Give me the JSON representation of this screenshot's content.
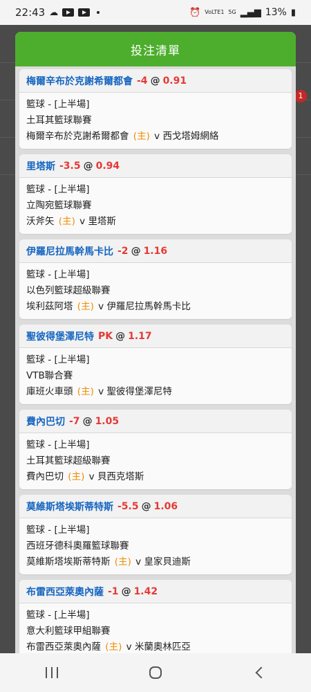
{
  "status_bar": {
    "time": "22:43",
    "battery": "13%",
    "network": "5G",
    "volte": "VoLTE1"
  },
  "background": {
    "badge_count": "1"
  },
  "modal": {
    "title": "投注清單",
    "home_marker": "(主)",
    "vs": "v",
    "bets": [
      {
        "selection": "梅爾辛布於克謝希爾都會",
        "line": "-4",
        "at": "@",
        "odds": "0.91",
        "sport_period": "籃球 - [上半場]",
        "league": "土耳其籃球聯賽",
        "home": "梅爾辛布於克謝希爾都會",
        "away": "西戈塔姆網絡"
      },
      {
        "selection": "里塔斯",
        "line": "-3.5",
        "at": "@",
        "odds": "0.94",
        "sport_period": "籃球 - [上半場]",
        "league": "立陶宛籃球聯賽",
        "home": "沃斧矢",
        "away": "里塔斯"
      },
      {
        "selection": "伊羅尼拉馬幹馬卡比",
        "line": "-2",
        "at": "@",
        "odds": "1.16",
        "sport_period": "籃球 - [上半場]",
        "league": "以色列籃球超級聯賽",
        "home": "埃利茲阿塔",
        "away": "伊羅尼拉馬幹馬卡比"
      },
      {
        "selection": "聖彼得堡澤尼特",
        "line": "PK",
        "at": "@",
        "odds": "1.17",
        "sport_period": "籃球 - [上半場]",
        "league": "VTB聯合賽",
        "home": "庫班火車頭",
        "away": "聖彼得堡澤尼特"
      },
      {
        "selection": "費內巴切",
        "line": "-7",
        "at": "@",
        "odds": "1.05",
        "sport_period": "籃球 - [上半場]",
        "league": "土耳其籃球超級聯賽",
        "home": "費內巴切",
        "away": "貝西克塔斯"
      },
      {
        "selection": "莫維斯塔埃斯蒂特斯",
        "line": "-5.5",
        "at": "@",
        "odds": "1.06",
        "sport_period": "籃球 - [上半場]",
        "league": "西班牙德科奧羅籃球聯賽",
        "home": "莫維斯塔埃斯蒂特斯",
        "away": "皇家貝迪斯"
      },
      {
        "selection": "布雷西亞萊奧內薩",
        "line": "-1",
        "at": "@",
        "odds": "1.42",
        "sport_period": "籃球 - [上半場]",
        "league": "意大利籃球甲組聯賽",
        "home": "布雷西亞萊奧內薩",
        "away": "米蘭奧林匹亞"
      }
    ]
  },
  "colors": {
    "header_green": "#4cae2c",
    "selection_blue": "#1565c0",
    "odds_red": "#e53935",
    "home_orange": "#f08c00"
  }
}
